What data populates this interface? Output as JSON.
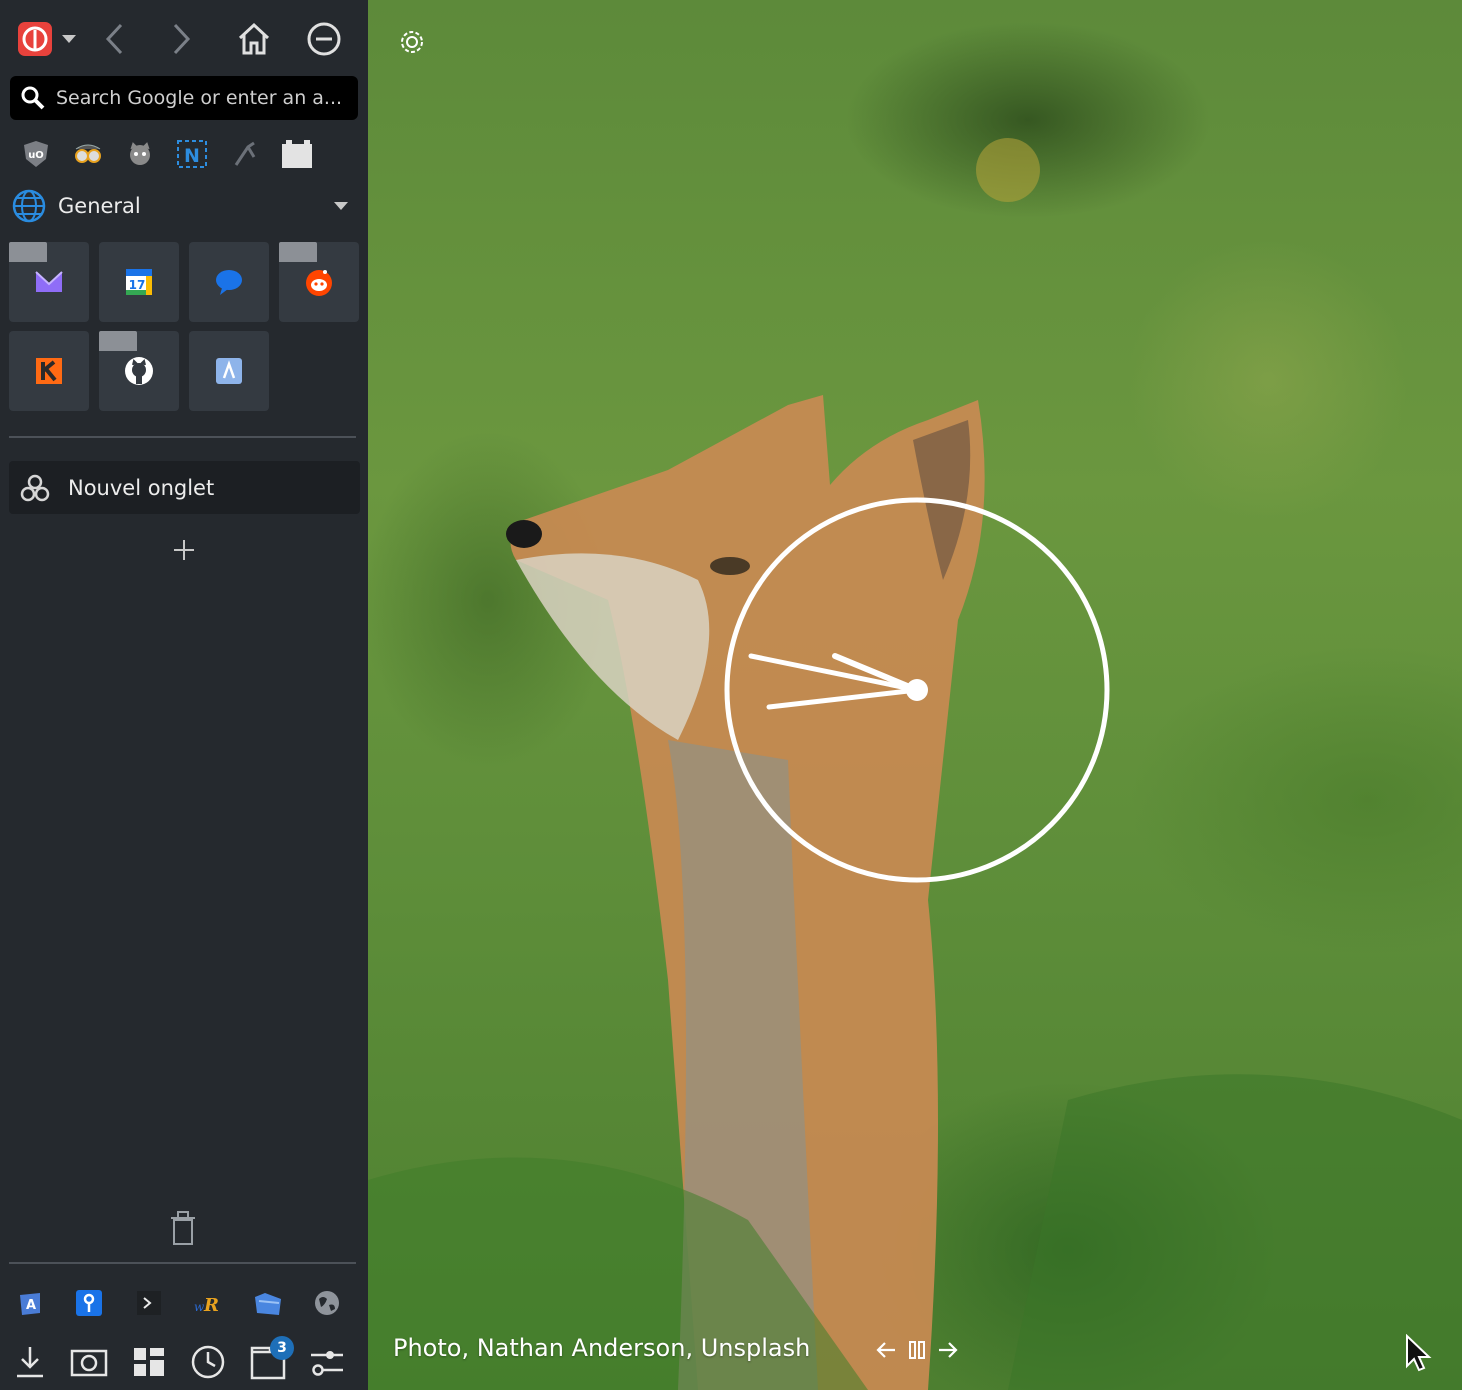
{
  "search": {
    "placeholder": "Search Google or enter an a..."
  },
  "workspace": {
    "label": "General"
  },
  "tab": {
    "title": "Nouvel onglet"
  },
  "photo": {
    "credit": "Photo, Nathan Anderson, Unsplash"
  },
  "tabs_badge": {
    "count": "3"
  },
  "icons": {
    "toolbar": [
      "app-menu-icon",
      "back-icon",
      "forward-icon",
      "home-icon",
      "minimize-icon"
    ],
    "extensions": [
      "ublock-icon",
      "spy-glasses-icon",
      "cat-icon",
      "notion-icon",
      "tool-icon",
      "plugin-icon"
    ],
    "speed_dial": [
      "proton-mail-icon",
      "calendar-icon",
      "chat-icon",
      "reddit-icon",
      "kagi-icon",
      "github-icon",
      "app-icon"
    ],
    "bottom_apps": [
      "translate-icon",
      "password-icon",
      "terminal-icon",
      "wordreference-icon",
      "files-icon",
      "globe-icon"
    ],
    "bottom_bar": [
      "downloads-icon",
      "screenshot-icon",
      "dashboard-icon",
      "history-icon",
      "tabs-icon",
      "settings-sliders-icon"
    ]
  },
  "colors": {
    "sidebar_bg": "#25292e",
    "tile_bg": "#343a41",
    "accent_blue": "#1a73e8"
  }
}
